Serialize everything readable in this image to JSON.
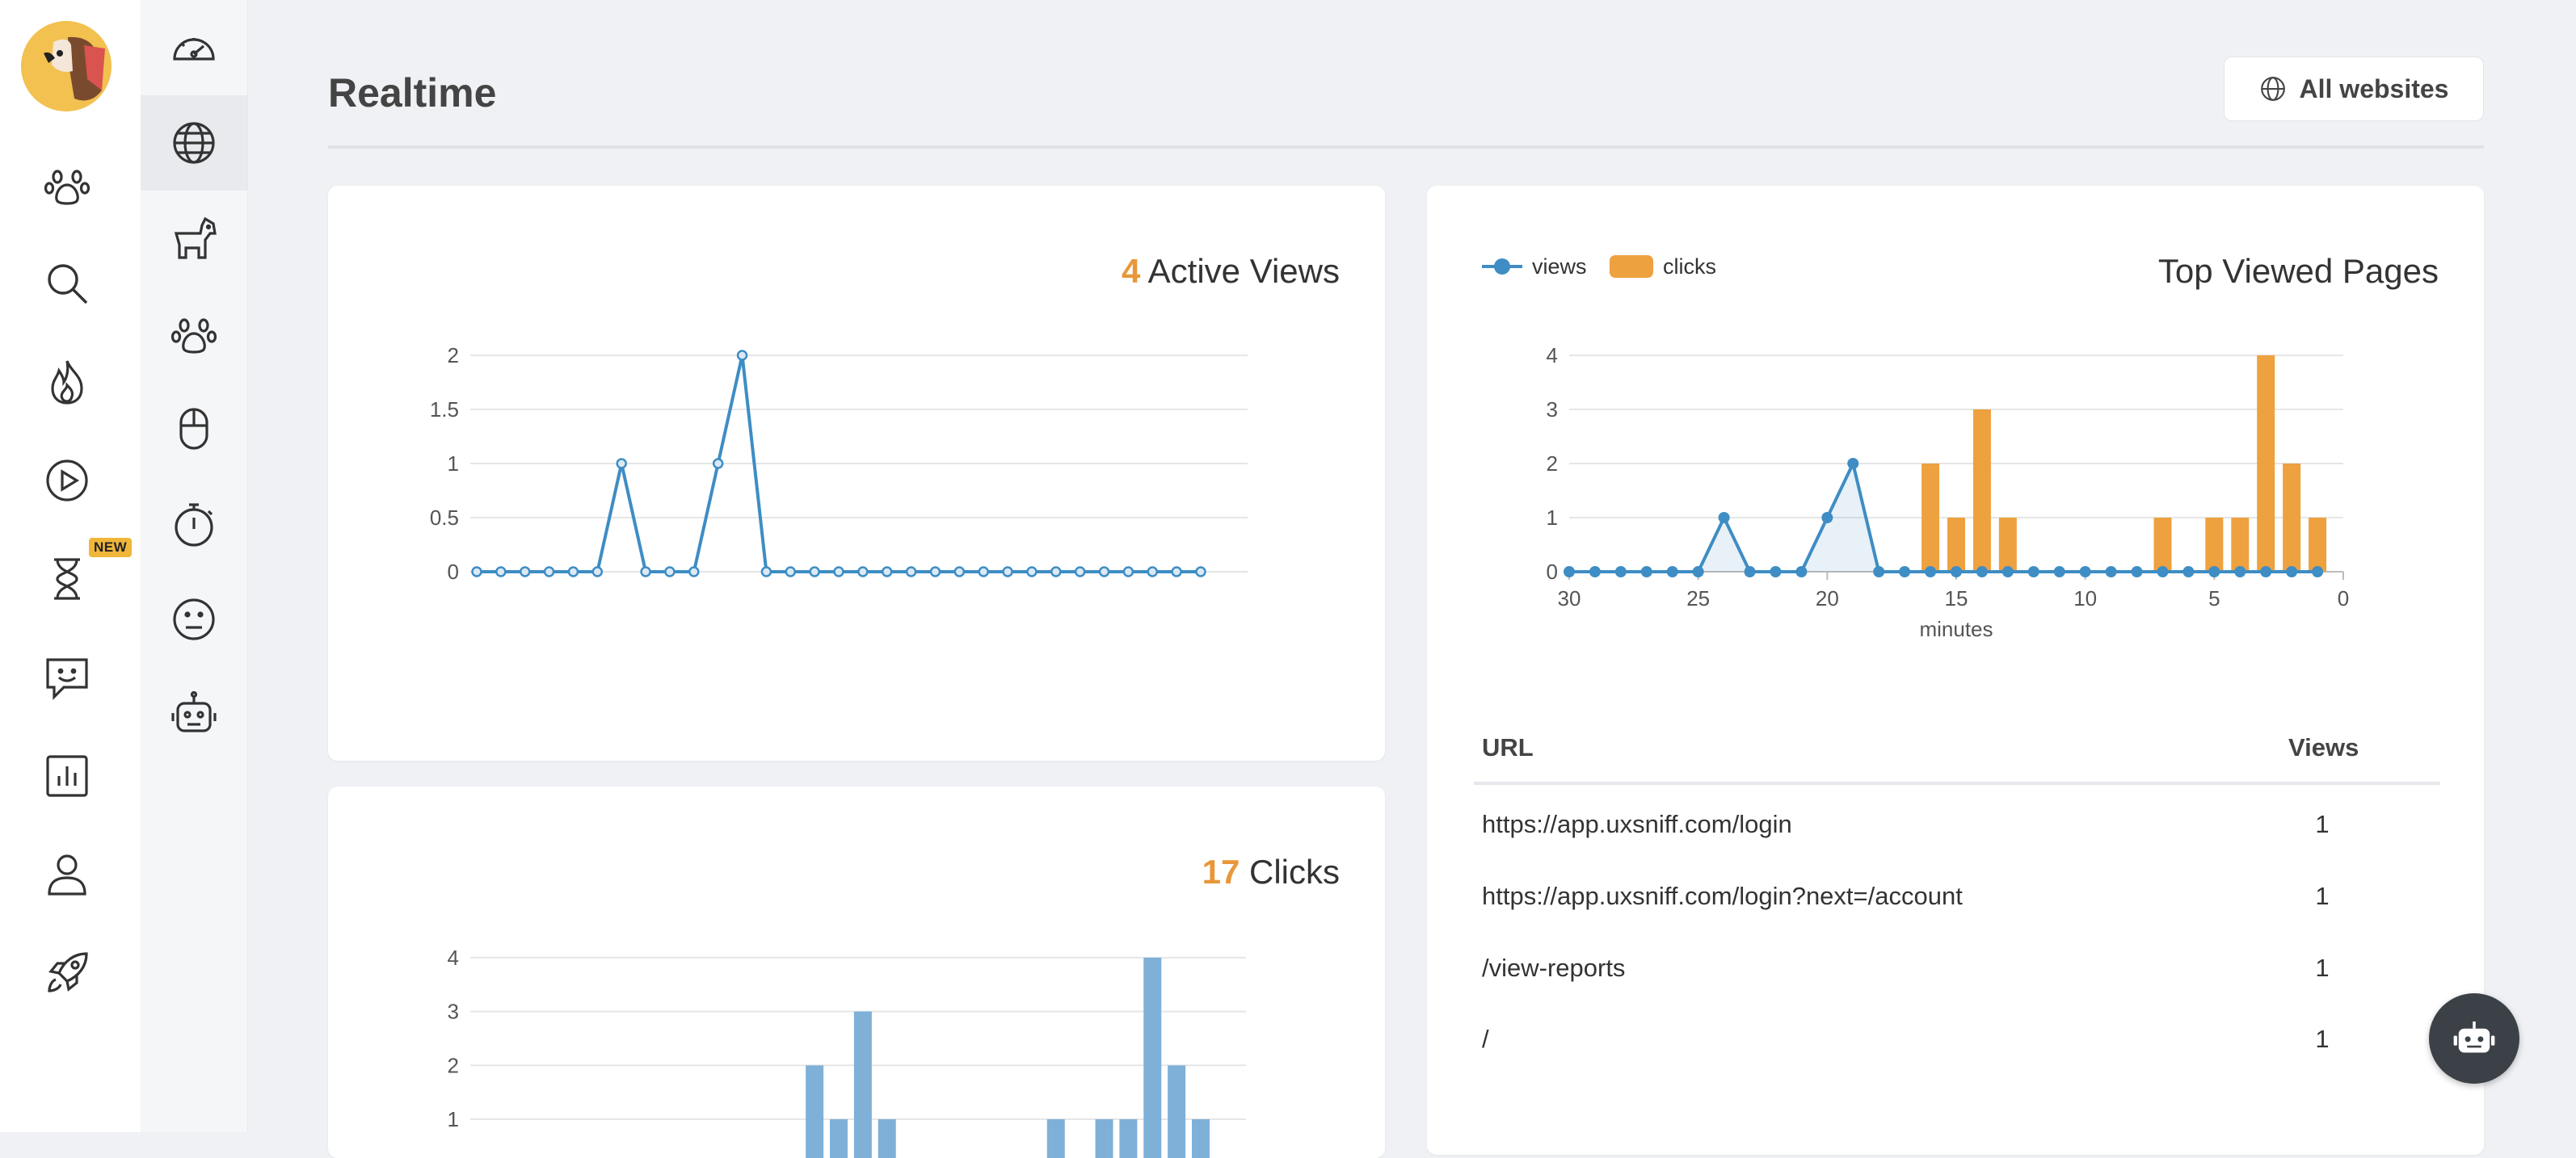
{
  "page": {
    "title": "Realtime",
    "all_websites_label": "All websites"
  },
  "sidebar": {
    "badge_new": "NEW",
    "primary_icons": [
      "paw-icon",
      "search-icon",
      "fire-icon",
      "play-icon",
      "hourglass-icon",
      "chat-smile-icon",
      "bar-chart-icon",
      "user-icon",
      "rocket-icon"
    ],
    "secondary_icons": [
      "gauge-icon",
      "globe-icon",
      "dog-icon",
      "paw-icon",
      "mouse-icon",
      "stopwatch-icon",
      "neutral-face-icon",
      "robot-icon"
    ],
    "secondary_active": 1
  },
  "active_views": {
    "count": "4",
    "label": "Active Views"
  },
  "clicks_card": {
    "count": "17",
    "label": "Clicks"
  },
  "top_pages": {
    "title": "Top Viewed Pages",
    "legend": {
      "views": "views",
      "clicks": "clicks"
    },
    "table": {
      "headers": {
        "url": "URL",
        "views": "Views"
      },
      "rows": [
        {
          "url": "https://app.uxsniff.com/login",
          "views": "1"
        },
        {
          "url": "https://app.uxsniff.com/login?next=/account",
          "views": "1"
        },
        {
          "url": "/view-reports",
          "views": "1"
        },
        {
          "url": "/",
          "views": "1"
        }
      ]
    }
  },
  "colors": {
    "accent_orange": "#e8973a",
    "line_blue": "#3e8dc4",
    "bar_blue": "#7fb0d8"
  },
  "chart_data": [
    {
      "type": "line",
      "name": "active-views-chart",
      "x": [
        "",
        "",
        "",
        "",
        "",
        "",
        "",
        "",
        "",
        "",
        "",
        "",
        "",
        "",
        "",
        "",
        "",
        "",
        "",
        "",
        "",
        "",
        "",
        "",
        "",
        "",
        "",
        "",
        "",
        "",
        "",
        ""
      ],
      "values": [
        0,
        0,
        0,
        0,
        0,
        0,
        1,
        0,
        0,
        0,
        1,
        2,
        0,
        0,
        0,
        0,
        0,
        0,
        0,
        0,
        0,
        0,
        0,
        0,
        0,
        0,
        0,
        0,
        0,
        0,
        0
      ],
      "yticks": [
        "0",
        "0.5",
        "1",
        "1.5",
        "2"
      ],
      "ylim": [
        0,
        2
      ]
    },
    {
      "type": "bar",
      "name": "clicks-chart",
      "values": [
        0,
        0,
        0,
        0,
        0,
        0,
        0,
        0,
        0,
        0,
        0,
        0,
        0,
        0,
        2,
        1,
        3,
        1,
        0,
        0,
        0,
        0,
        0,
        0,
        1,
        0,
        1,
        1,
        4,
        2,
        1
      ],
      "yticks": [
        "1",
        "2",
        "3",
        "4"
      ],
      "ylim": [
        0,
        4
      ]
    },
    {
      "type": "bar+line",
      "name": "top-pages-chart",
      "xlabel": "minutes",
      "xticks": [
        "30",
        "25",
        "20",
        "15",
        "10",
        "5",
        "0"
      ],
      "xlim": [
        30,
        0
      ],
      "yticks": [
        "0",
        "1",
        "2",
        "3",
        "4"
      ],
      "ylim": [
        0,
        4
      ],
      "series": [
        {
          "name": "views",
          "type": "line",
          "x": [
            30,
            29,
            28,
            27,
            26,
            25,
            24,
            23,
            22,
            21,
            20,
            19,
            18,
            17,
            16,
            15,
            14,
            13,
            12,
            11,
            10,
            9,
            8,
            7,
            6,
            5,
            4,
            3,
            2,
            1
          ],
          "values": [
            0,
            0,
            0,
            0,
            0,
            0,
            1,
            0,
            0,
            0,
            1,
            2,
            0,
            0,
            0,
            0,
            0,
            0,
            0,
            0,
            0,
            0,
            0,
            0,
            0,
            0,
            0,
            0,
            0,
            0
          ]
        },
        {
          "name": "clicks",
          "type": "bar",
          "x": [
            16,
            15,
            14,
            13,
            7,
            5,
            4,
            3,
            2,
            1
          ],
          "values": [
            2,
            1,
            3,
            1,
            1,
            1,
            1,
            4,
            2,
            1
          ]
        }
      ]
    }
  ]
}
